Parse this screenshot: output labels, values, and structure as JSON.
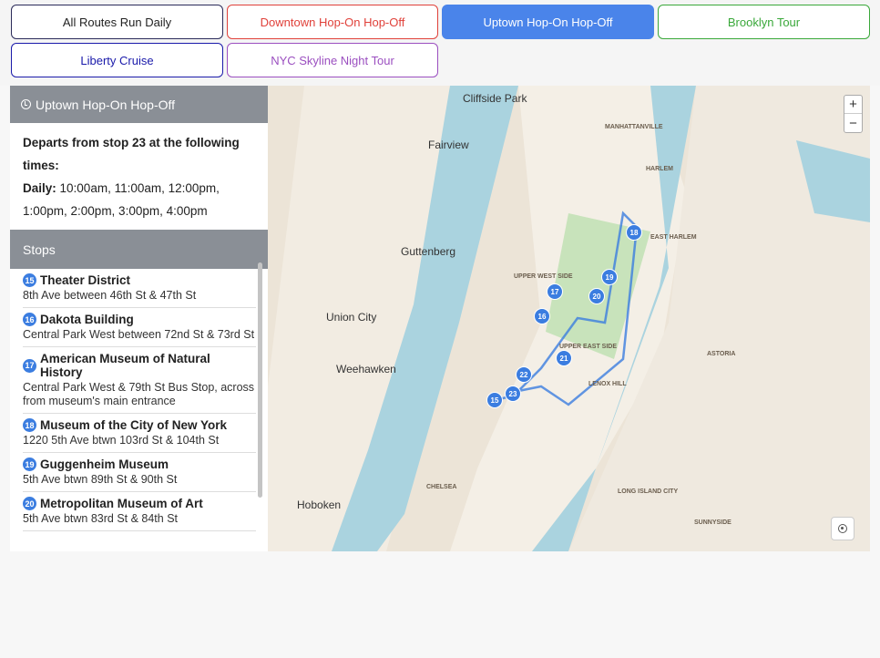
{
  "tabs": [
    {
      "label": "All Routes Run Daily",
      "color": "#222222",
      "border": "#2b2b5a",
      "active": false
    },
    {
      "label": "Downtown Hop-On Hop-Off",
      "color": "#e0413a",
      "border": "#e0413a",
      "active": false
    },
    {
      "label": "Uptown Hop-On Hop-Off",
      "color": "#ffffff",
      "border": "#4a84ea",
      "active": true
    },
    {
      "label": "Brooklyn Tour",
      "color": "#3aa83a",
      "border": "#3aa83a",
      "active": false
    },
    {
      "label": "Liberty Cruise",
      "color": "#1a1aaa",
      "border": "#1a1aaa",
      "active": false
    },
    {
      "label": "NYC Skyline Night Tour",
      "color": "#9b4fc0",
      "border": "#9b4fc0",
      "active": false
    }
  ],
  "sidebar": {
    "route_title": "Uptown Hop-On Hop-Off",
    "departs_text": "Departs from stop 23 at the following times:",
    "daily_label": "Daily:",
    "daily_times": "10:00am, 11:00am, 12:00pm, 1:00pm, 2:00pm, 3:00pm, 4:00pm",
    "stops_label": "Stops",
    "stops": [
      {
        "num": "15",
        "name": "Theater District",
        "addr": "8th Ave between 46th St & 47th St"
      },
      {
        "num": "16",
        "name": "Dakota Building",
        "addr": "Central Park West between 72nd St & 73rd St"
      },
      {
        "num": "17",
        "name": "American Museum of Natural History",
        "addr": "Central Park West & 79th St Bus Stop, across from museum's main entrance"
      },
      {
        "num": "18",
        "name": "Museum of the City of New York",
        "addr": "1220 5th Ave btwn 103rd St & 104th St"
      },
      {
        "num": "19",
        "name": "Guggenheim Museum",
        "addr": "5th Ave btwn 89th St & 90th St"
      },
      {
        "num": "20",
        "name": "Metropolitan Museum of Art",
        "addr": "5th Ave btwn 83rd St & 84th St"
      }
    ]
  },
  "map": {
    "zoom_in": "+",
    "zoom_out": "−",
    "labels": [
      {
        "text": "Cliffside Park",
        "big": true
      },
      {
        "text": "Fairview",
        "big": true
      },
      {
        "text": "Guttenberg",
        "big": true
      },
      {
        "text": "Union City",
        "big": true
      },
      {
        "text": "Weehawken",
        "big": true
      },
      {
        "text": "Hoboken",
        "big": true
      },
      {
        "text": "MANHATTANVILLE",
        "big": false
      },
      {
        "text": "HARLEM",
        "big": false
      },
      {
        "text": "EAST HARLEM",
        "big": false
      },
      {
        "text": "UPPER WEST SIDE",
        "big": false
      },
      {
        "text": "UPPER EAST SIDE",
        "big": false
      },
      {
        "text": "LENOX HILL",
        "big": false
      },
      {
        "text": "CHELSEA",
        "big": false
      },
      {
        "text": "ASTORIA",
        "big": false
      },
      {
        "text": "LONG ISLAND CITY",
        "big": false
      },
      {
        "text": "SUNNYSIDE",
        "big": false
      }
    ],
    "pins": [
      "15",
      "16",
      "17",
      "18",
      "19",
      "20",
      "21",
      "22",
      "23"
    ]
  }
}
